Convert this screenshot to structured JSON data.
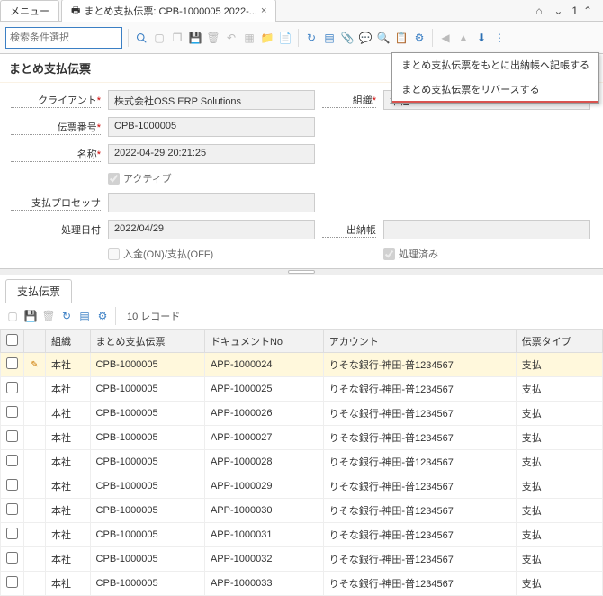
{
  "tabs": {
    "menu": "メニュー",
    "active": "まとめ支払伝票: CPB-1000005 2022-..."
  },
  "header_right": {
    "home": "⌂",
    "down1": "⌄",
    "num": "1",
    "up": "⌃"
  },
  "toolbar": {
    "search_placeholder": "検索条件選択"
  },
  "dropdown": {
    "item1": "まとめ支払伝票をもとに出納帳へ記帳する",
    "item2": "まとめ支払伝票をリバースする"
  },
  "section_title": "まとめ支払伝票",
  "form": {
    "client_lbl": "クライアント",
    "client_val": "株式会社OSS ERP Solutions",
    "org_lbl": "組織",
    "org_val": "本社",
    "docno_lbl": "伝票番号",
    "docno_val": "CPB-1000005",
    "name_lbl": "名称",
    "name_val": "2022-04-29 20:21:25",
    "active_lbl": "アクティブ",
    "processor_lbl": "支払プロセッサ",
    "processor_val": "",
    "date_lbl": "処理日付",
    "date_val": "2022/04/29",
    "cashbook_lbl": "出納帳",
    "cashbook_val": "",
    "deposit_lbl": "入金(ON)/支払(OFF)",
    "processed_lbl": "処理済み"
  },
  "sub_tab": "支払伝票",
  "grid": {
    "record_count": "10 レコード",
    "cols": {
      "c1": "組織",
      "c2": "まとめ支払伝票",
      "c3": "ドキュメントNo",
      "c4": "アカウント",
      "c5": "伝票タイプ"
    },
    "rows": [
      {
        "org": "本社",
        "group": "CPB-1000005",
        "doc": "APP-1000024",
        "acct": "りそな銀行-神田-普1234567",
        "type": "支払"
      },
      {
        "org": "本社",
        "group": "CPB-1000005",
        "doc": "APP-1000025",
        "acct": "りそな銀行-神田-普1234567",
        "type": "支払"
      },
      {
        "org": "本社",
        "group": "CPB-1000005",
        "doc": "APP-1000026",
        "acct": "りそな銀行-神田-普1234567",
        "type": "支払"
      },
      {
        "org": "本社",
        "group": "CPB-1000005",
        "doc": "APP-1000027",
        "acct": "りそな銀行-神田-普1234567",
        "type": "支払"
      },
      {
        "org": "本社",
        "group": "CPB-1000005",
        "doc": "APP-1000028",
        "acct": "りそな銀行-神田-普1234567",
        "type": "支払"
      },
      {
        "org": "本社",
        "group": "CPB-1000005",
        "doc": "APP-1000029",
        "acct": "りそな銀行-神田-普1234567",
        "type": "支払"
      },
      {
        "org": "本社",
        "group": "CPB-1000005",
        "doc": "APP-1000030",
        "acct": "りそな銀行-神田-普1234567",
        "type": "支払"
      },
      {
        "org": "本社",
        "group": "CPB-1000005",
        "doc": "APP-1000031",
        "acct": "りそな銀行-神田-普1234567",
        "type": "支払"
      },
      {
        "org": "本社",
        "group": "CPB-1000005",
        "doc": "APP-1000032",
        "acct": "りそな銀行-神田-普1234567",
        "type": "支払"
      },
      {
        "org": "本社",
        "group": "CPB-1000005",
        "doc": "APP-1000033",
        "acct": "りそな銀行-神田-普1234567",
        "type": "支払"
      }
    ]
  }
}
